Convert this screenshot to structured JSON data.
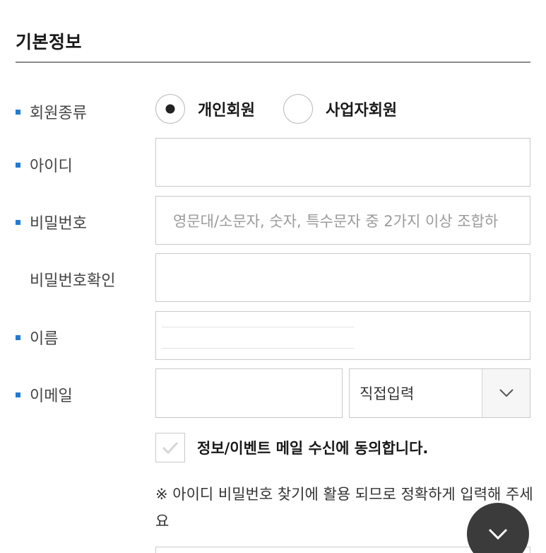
{
  "section": {
    "title": "기본정보"
  },
  "member_type": {
    "label": "회원종류",
    "options": [
      {
        "label": "개인회원",
        "checked": true
      },
      {
        "label": "사업자회원",
        "checked": false
      }
    ]
  },
  "user_id": {
    "label": "아이디",
    "value": ""
  },
  "password": {
    "label": "비밀번호",
    "placeholder": "영문대/소문자, 숫자, 특수문자 중 2가지 이상 조합하"
  },
  "password_confirm": {
    "label": "비밀번호확인",
    "value": ""
  },
  "name": {
    "label": "이름",
    "value": ""
  },
  "email": {
    "label": "이메일",
    "local_value": "",
    "domain_selected": "직접입력"
  },
  "agreement": {
    "label": "정보/이벤트 메일 수신에 동의합니다.",
    "checked": true
  },
  "notice": {
    "text": "※ 아이디 비밀번호 찾기에 활용 되므로 정확하게 입력해 주세요"
  },
  "colors": {
    "accent_bullet": "#1f7bd6",
    "border": "#c9c9c9",
    "fab_bg": "#3b3b3b"
  },
  "icons": {
    "select_toggle": "chevron-down-icon",
    "checkbox": "check-icon",
    "fab": "chevron-down-icon"
  }
}
